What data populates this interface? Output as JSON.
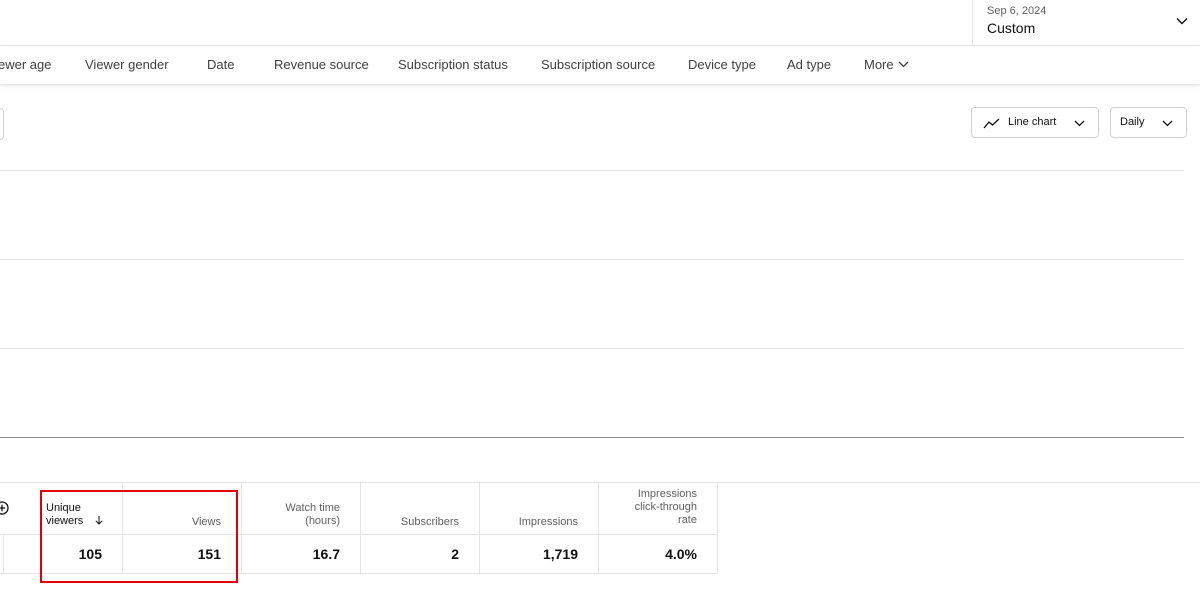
{
  "date_selector": {
    "range": "Sep 6, 2024",
    "value": "Custom"
  },
  "tabs": [
    {
      "label": "ewer age"
    },
    {
      "label": "Viewer gender"
    },
    {
      "label": "Date"
    },
    {
      "label": "Revenue source"
    },
    {
      "label": "Subscription status"
    },
    {
      "label": "Subscription source"
    },
    {
      "label": "Device type"
    },
    {
      "label": "Ad type"
    },
    {
      "label": "More"
    }
  ],
  "toolbar": {
    "chart_type": "Line chart",
    "period": "Daily"
  },
  "icons": {
    "date_chevron": "chevron-down-icon",
    "more_chevron": "chevron-down-icon",
    "chart_type": "line-chart-icon",
    "add_column": "add-circle-icon",
    "sort": "arrow-down-icon"
  },
  "table": {
    "columns": [
      {
        "label_line1": "Unique",
        "label_line2": "viewers",
        "value": "105"
      },
      {
        "label": "Views",
        "value": "151"
      },
      {
        "label_line1": "Watch time",
        "label_line2": "(hours)",
        "value": "16.7"
      },
      {
        "label": "Subscribers",
        "value": "2"
      },
      {
        "label": "Impressions",
        "value": "1,719"
      },
      {
        "label_line1": "Impressions",
        "label_line2": "click-through",
        "label_line3": "rate",
        "value": "4.0%"
      }
    ]
  },
  "colors": {
    "highlight": "#e00000",
    "border": "#e5e5e5"
  }
}
